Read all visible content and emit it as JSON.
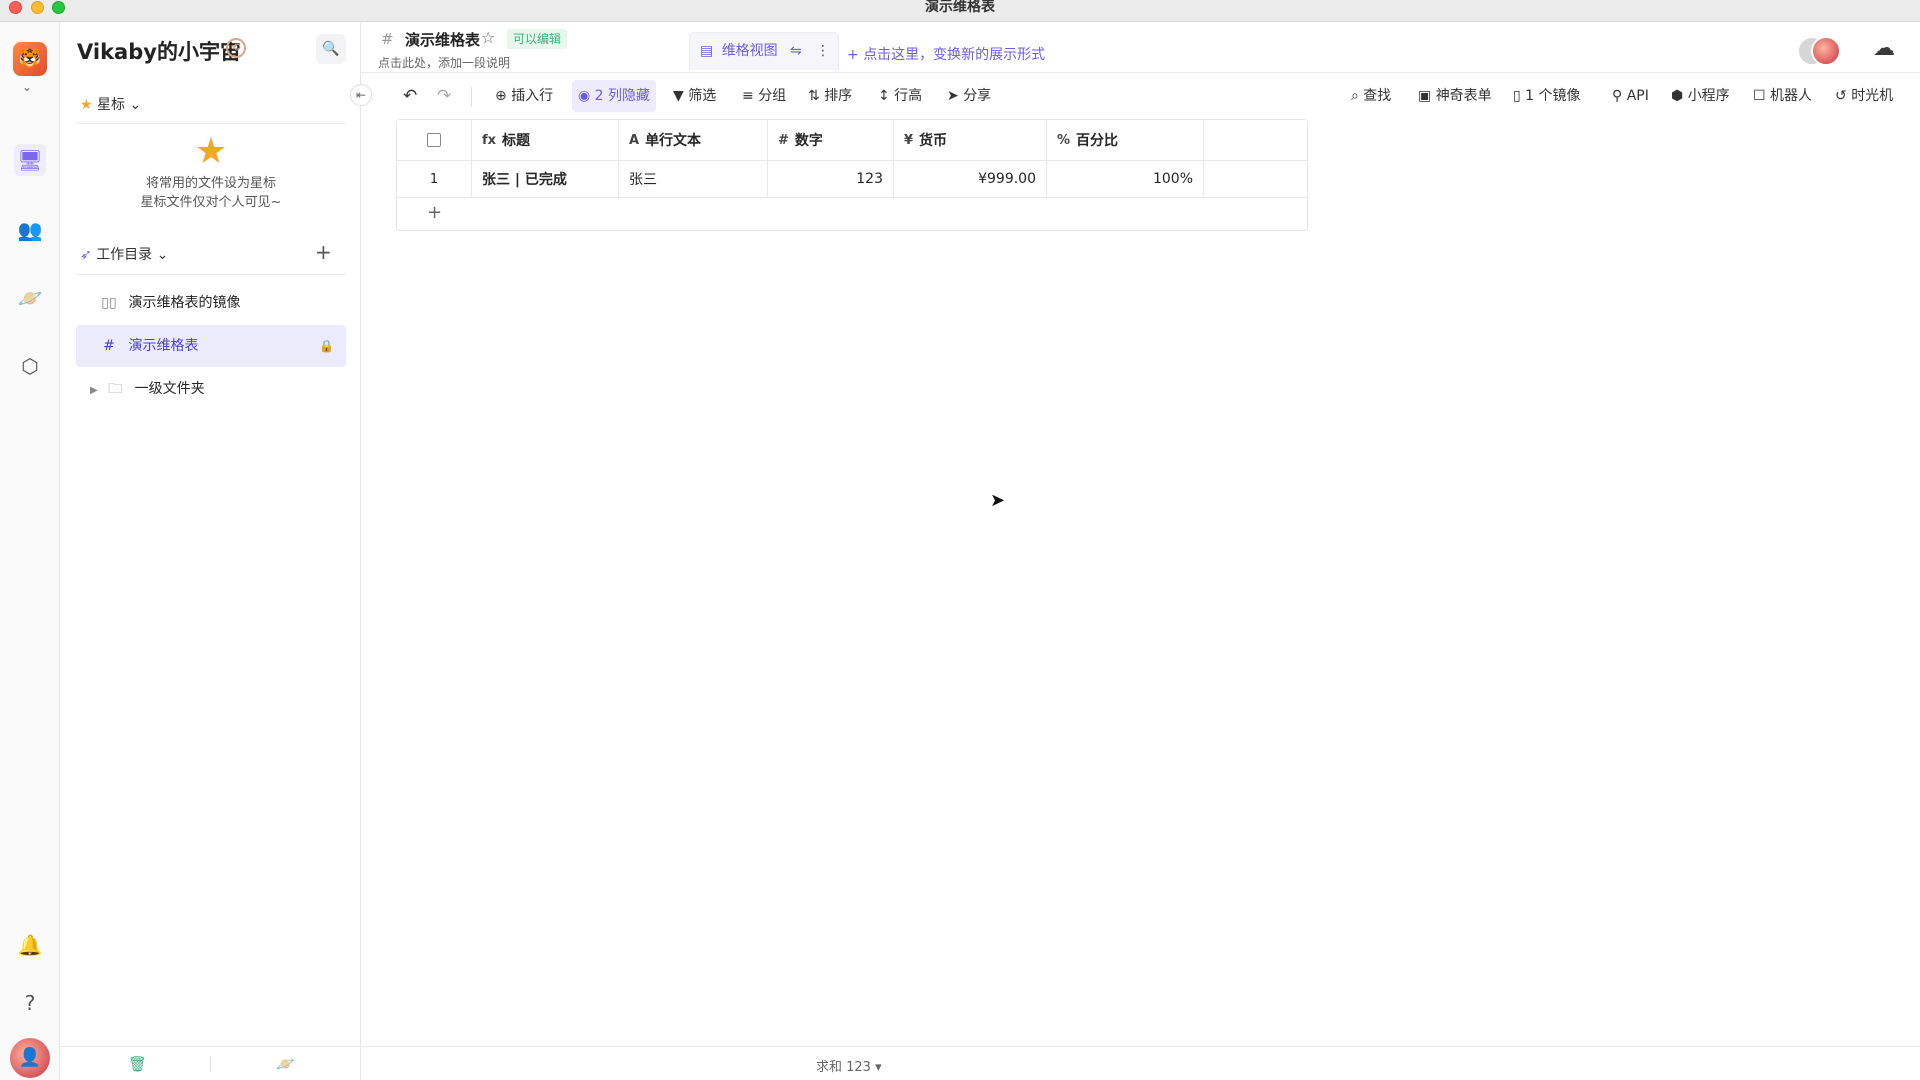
{
  "window": {
    "title": "演示维格表"
  },
  "rail": {
    "logo_glyph": "🐯",
    "avatar_glyph": "👤"
  },
  "sidebar": {
    "space_name": "Vikaby的小宇宙",
    "badge_glyph": "⟲",
    "star_section": "星标",
    "star_empty_line1": "将常用的文件设为星标",
    "star_empty_line2": "星标文件仅对个人可见~",
    "workdir_section": "工作目录",
    "items": [
      {
        "label": "演示维格表的镜像",
        "icon": "mirror-icon"
      },
      {
        "label": "演示维格表",
        "icon": "datasheet-icon",
        "active": true
      },
      {
        "label": "一级文件夹",
        "icon": "folder-icon"
      }
    ]
  },
  "header": {
    "title": "演示维格表",
    "edit_badge": "可以编辑",
    "description": "点击此处，添加一段说明",
    "view_tab": "维格视图",
    "add_view": "点击这里，变换新的展示形式"
  },
  "toolbar": {
    "insert_row": "插入行",
    "hidden_cols": "2 列隐藏",
    "filter": "筛选",
    "group": "分组",
    "sort": "排序",
    "row_height": "行高",
    "share": "分享",
    "find": "查找",
    "magic_form": "神奇表单",
    "mirror": "1 个镜像",
    "api": "API",
    "widget": "小程序",
    "robot": "机器人",
    "time_machine": "时光机"
  },
  "grid": {
    "columns": [
      {
        "icon": "fx",
        "label": "标题"
      },
      {
        "icon": "A",
        "label": "单行文本"
      },
      {
        "icon": "#",
        "label": "数字"
      },
      {
        "icon": "¥",
        "label": "货币"
      },
      {
        "icon": "%",
        "label": "百分比"
      }
    ],
    "rows": [
      {
        "index": "1",
        "cells": [
          "张三 | 已完成",
          "张三",
          "123",
          "¥999.00",
          "100%"
        ]
      }
    ],
    "add_row": "+"
  },
  "footer": {
    "summary": "求和 123 ▾"
  },
  "colors": {
    "accent": "#6b5ce7",
    "edit_badge_bg": "#e6f7ee",
    "edit_badge_text": "#3bb27e",
    "star": "#f5a623"
  }
}
